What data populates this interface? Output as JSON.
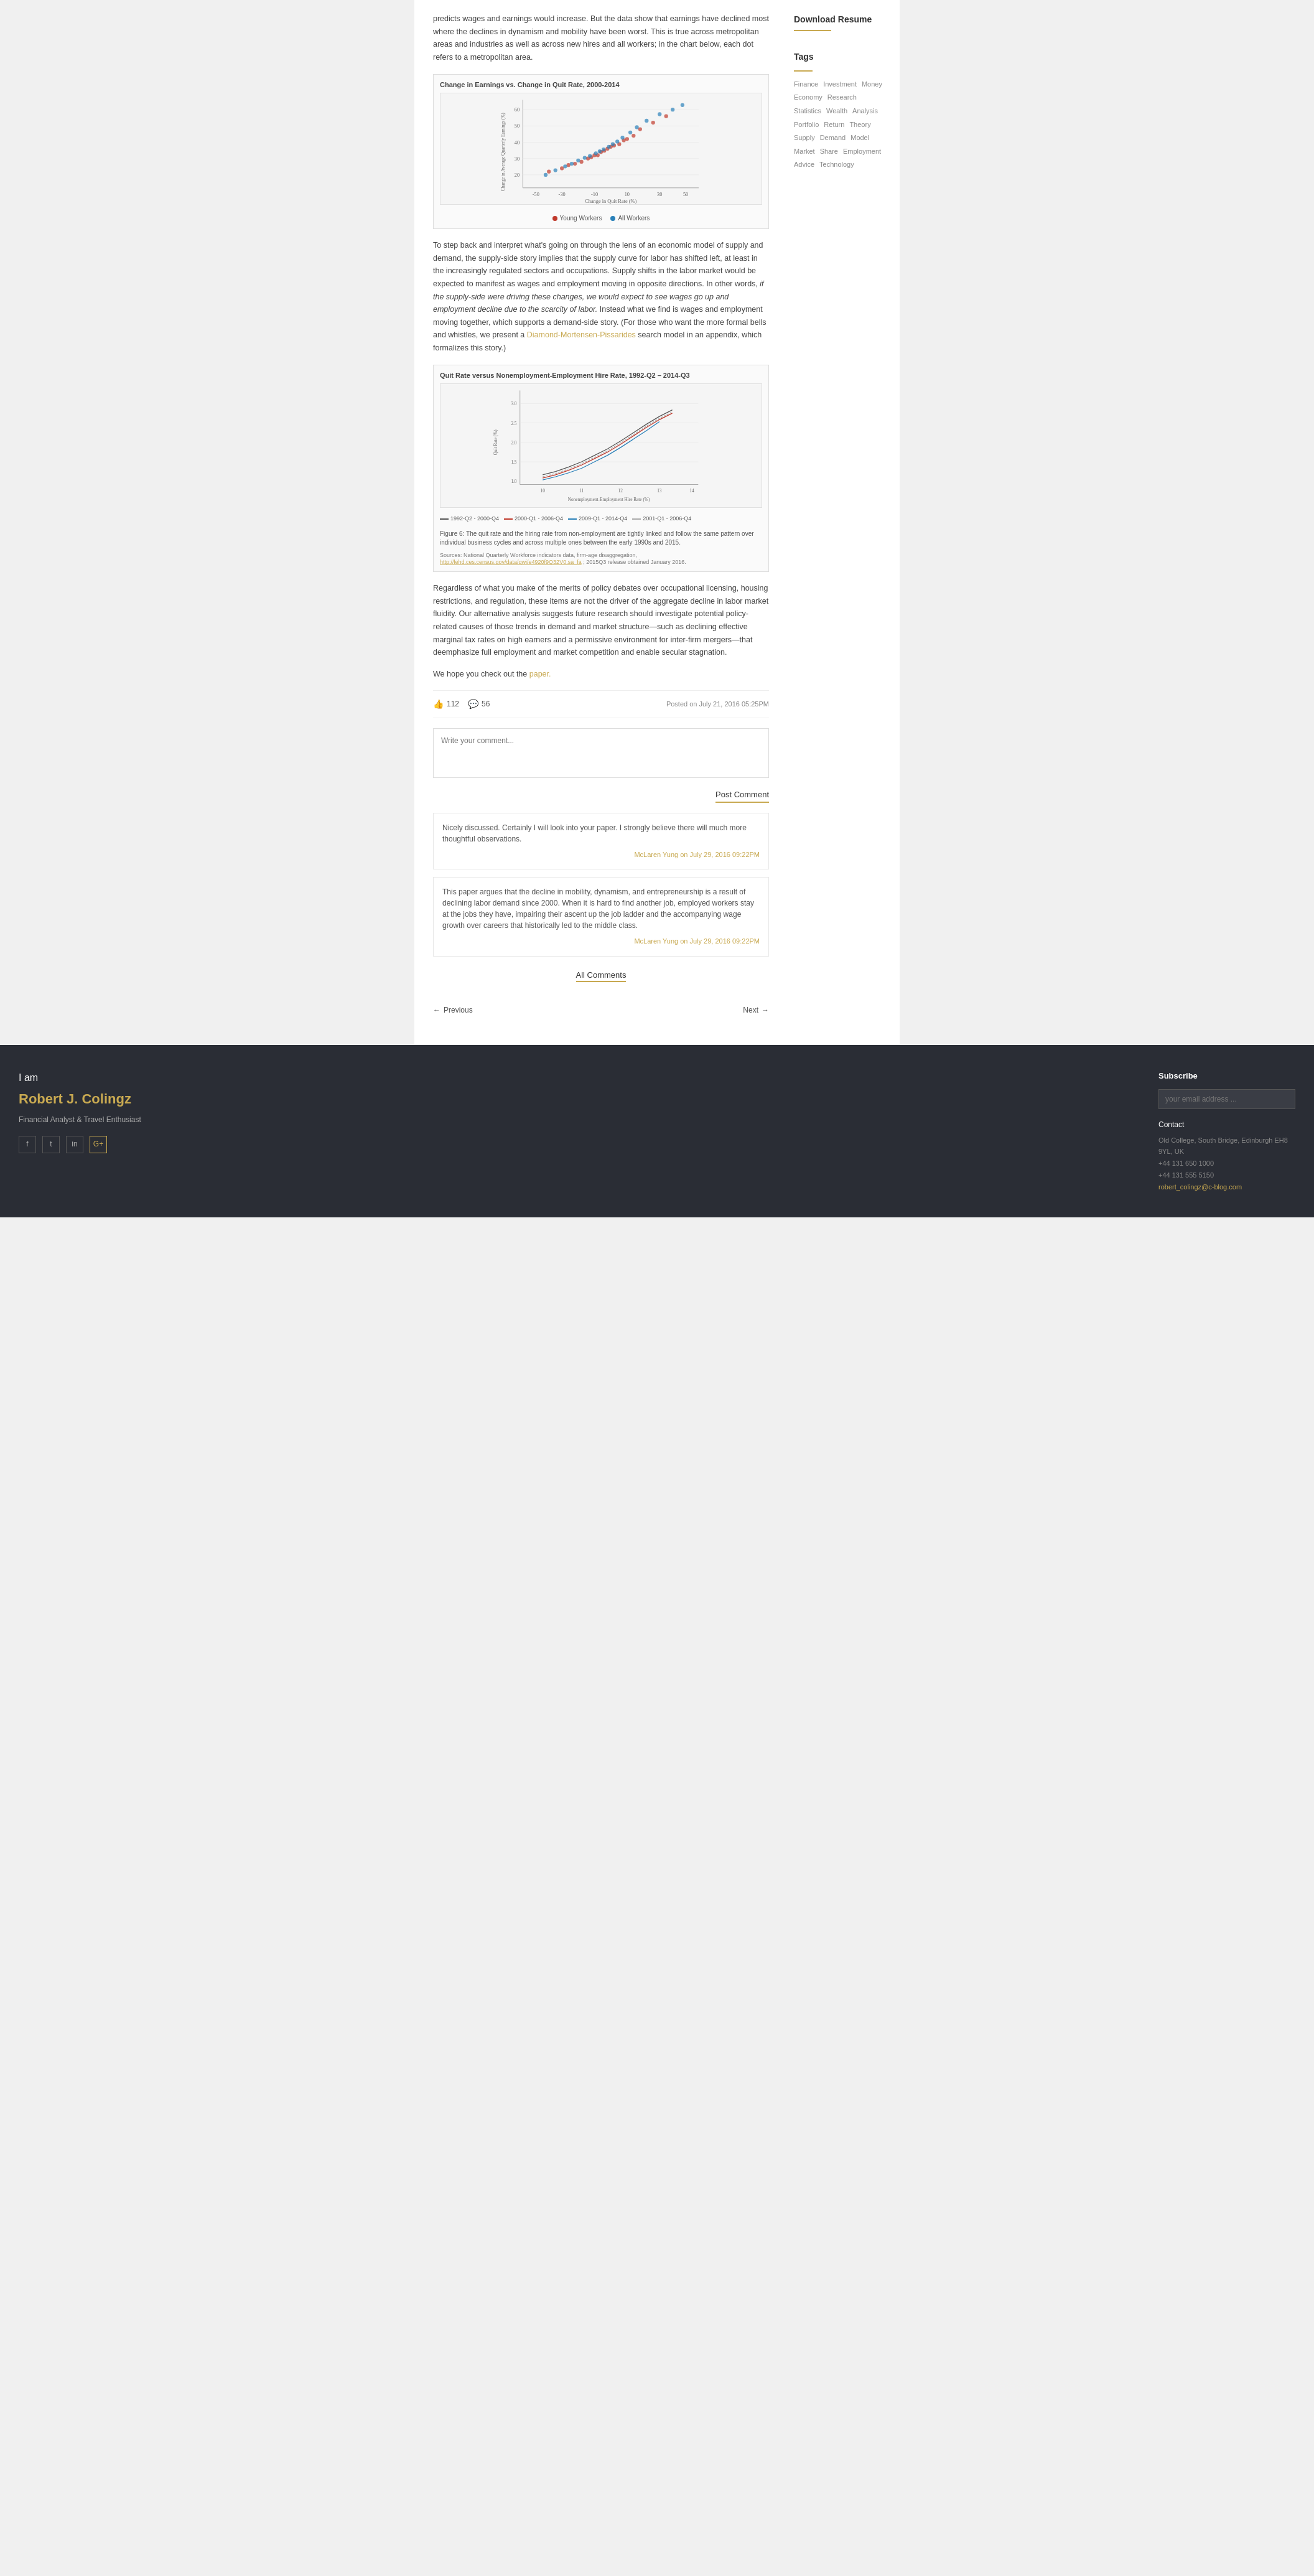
{
  "sidebar": {
    "download_resume_label": "Download Resume",
    "tags_label": "Tags",
    "tags": [
      [
        "Finance",
        "Investment",
        "Money"
      ],
      [
        "Economy",
        "Research"
      ],
      [
        "Statistics",
        "Wealth",
        "Analysis"
      ],
      [
        "Portfolio",
        "Return",
        "Theory"
      ],
      [
        "Supply",
        "Demand",
        "Model"
      ],
      [
        "Market",
        "Share",
        "Employment"
      ],
      [
        "Advice",
        "Technology"
      ]
    ]
  },
  "article": {
    "intro_text": "predicts wages and earnings would increase. But the data show that earnings have declined most where the declines in dynamism and mobility have been worst. This is true across metropolitan areas and industries as well as across new hires and all workers; in the chart below, each dot refers to a metropolitan area.",
    "chart1_title": "Change in Earnings vs. Change in Quit Rate, 2000-2014",
    "chart1_y_label": "Change in Average Quarterly Earnings (%)",
    "chart1_x_label": "Change in Quit Rate (%)",
    "chart1_legend": [
      "Young Workers",
      "All Workers"
    ],
    "body_text1": "To step back and interpret what's going on through the lens of an economic model of supply and demand, the supply-side story implies that the supply curve for labor has shifted left, at least in the increasingly regulated sectors and occupations. Supply shifts in the labor market would be expected to manifest as wages and employment moving in opposite directions. In other words,",
    "body_text1_italic": "if the supply-side were driving these changes, we would expect to see wages go up and employment decline due to the scarcity of labor.",
    "body_text1_cont": "Instead what we find is wages and employment moving together, which supports a demand-side story. (For those who want the more formal bells and whistles, we present a",
    "body_text1_link": "Diamond-Mortensen-Pissarides",
    "body_text1_end": "search model in an appendix, which formalizes this story.)",
    "chart2_title": "Quit Rate versus Nonemployment-Employment Hire Rate, 1992-Q2 – 2014-Q3",
    "chart2_y_label": "Quit Rate (%)",
    "chart2_x_label": "Nonemployment-Employment Hire Rate (%)",
    "chart2_legend": [
      "1992-Q2 - 2000-Q4",
      "2000-Q1 - 2006-Q4",
      "2009-Q1 - 2014-Q4",
      "2001-Q1 - 2006-Q4"
    ],
    "chart2_caption": "Figure 6: The quit rate and the hiring rate from non-employment are tightly linked and follow the same pattern over individual business cycles and across multiple ones between the early 1990s and 2015.",
    "chart2_source_text": "Sources: National Quarterly Workforce indicators data, firm-age disaggregation,",
    "chart2_source_link": "http://lehd.ces.census.gov/data/qwi/e4920f9Q32V0.sa_fa",
    "chart2_source_end": "; 2015Q3 release obtained January 2016.",
    "body_text2": "Regardless of what you make of the merits of policy debates over occupational licensing, housing restrictions, and regulation, these items are not the driver of the aggregate decline in labor market fluidity. Our alternative analysis suggests future research should investigate potential policy-related causes of those trends in demand and market structure—such as declining effective marginal tax rates on high earners and a permissive environment for inter-firm mergers—that deemphasize full employment and market competition and enable secular stagnation.",
    "conclusion_text_start": "We hope you check out the",
    "conclusion_link": "paper.",
    "likes_count": "112",
    "comments_count": "56",
    "post_date": "Posted on July 21, 2016 05:25PM",
    "comment_placeholder": "Write your comment...",
    "post_comment_label": "Post Comment",
    "comments": [
      {
        "text": "Nicely discussed. Certainly I will look into your paper. I strongly believe there will much more thoughtful observations.",
        "author": "McLaren Yung on July 29, 2016 09:22PM"
      },
      {
        "text": "This paper argues that the decline in mobility, dynamism, and entrepreneurship is a result of declining labor demand since 2000. When it is hard to find another job, employed workers stay at the jobs they have, impairing their ascent up the job ladder and the accompanying wage growth over careers that historically led to the middle class.",
        "author": "McLaren Yung on July 29, 2016 09:22PM"
      }
    ],
    "all_comments_label": "All Comments",
    "prev_label": "Previous",
    "next_label": "Next"
  },
  "footer": {
    "intro": "I am",
    "name": "Robert J. Colingz",
    "subtitle": "Financial Analyst & Travel Enthusiast",
    "subscribe_label": "Subscribe",
    "subscribe_placeholder": "your email address ...",
    "contact_label": "Contact",
    "contact_address": "Old College, South Bridge, Edinburgh EH8 9YL, UK",
    "contact_phone1": "+44 131 650 1000",
    "contact_phone2": "+44 131 555 5150",
    "contact_email": "robert_colingz@c-blog.com",
    "socials": [
      "f",
      "t",
      "in",
      "G+"
    ]
  }
}
